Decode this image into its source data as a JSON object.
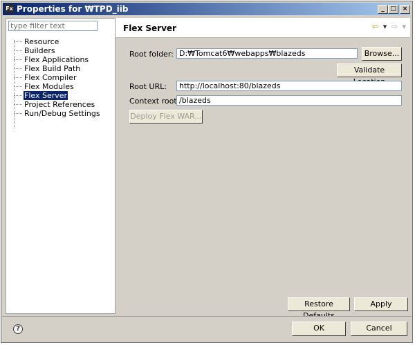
{
  "window": {
    "title": "Properties for ₩TPD_iib",
    "app_icon_text": "Fx",
    "minimize_glyph": "_",
    "maximize_glyph": "□",
    "close_glyph": "×"
  },
  "sidebar": {
    "filter_placeholder": "type filter text",
    "items": [
      {
        "label": "Resource",
        "selected": false
      },
      {
        "label": "Builders",
        "selected": false
      },
      {
        "label": "Flex Applications",
        "selected": false
      },
      {
        "label": "Flex Build Path",
        "selected": false
      },
      {
        "label": "Flex Compiler",
        "selected": false
      },
      {
        "label": "Flex Modules",
        "selected": false
      },
      {
        "label": "Flex Server",
        "selected": true
      },
      {
        "label": "Project References",
        "selected": false
      },
      {
        "label": "Run/Debug Settings",
        "selected": false
      }
    ]
  },
  "main": {
    "title": "Flex Server",
    "nav": {
      "back_glyph": "⇦",
      "dropdown_glyph": "▾",
      "forward_glyph": "⇨"
    },
    "root_folder": {
      "label": "Root folder:",
      "value": "D:₩Tomcat6₩webapps₩blazeds",
      "browse_label": "Browse..."
    },
    "validate_label": "Validate Location",
    "root_url": {
      "label": "Root URL:",
      "value": "http://localhost:80/blazeds"
    },
    "context_root": {
      "label": "Context root:",
      "value": "/blazeds"
    },
    "deploy_label": "Deploy Flex WAR...",
    "restore_defaults_label": "Restore Defaults",
    "apply_label": "Apply"
  },
  "footer": {
    "help_glyph": "?",
    "ok_label": "OK",
    "cancel_label": "Cancel"
  },
  "colors": {
    "title_bar_start": "#0a246a",
    "title_bar_end": "#a6caf0",
    "selection": "#0a246a",
    "dialog_bg": "#d4d0c8"
  }
}
